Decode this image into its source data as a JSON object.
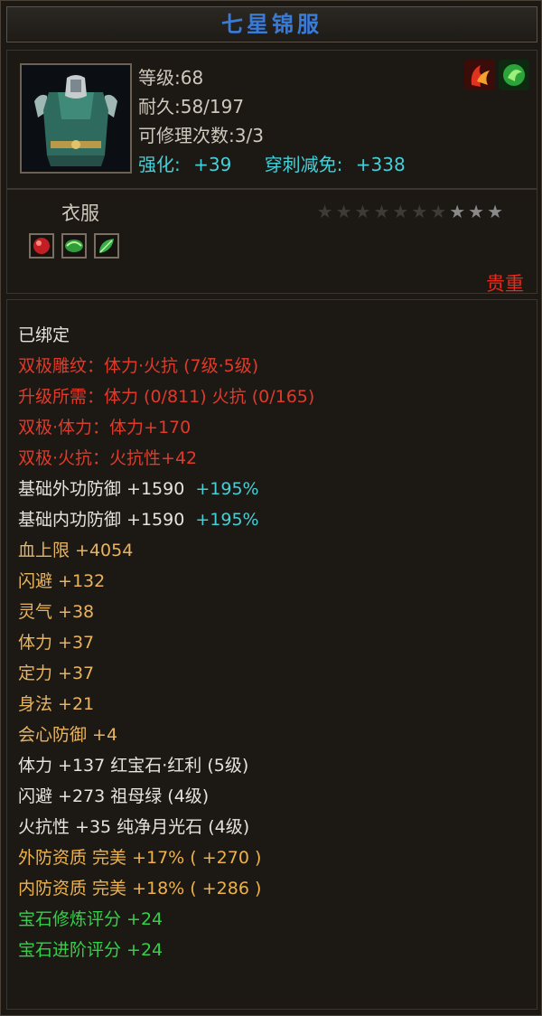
{
  "item": {
    "name": "七星锦服",
    "level": "等级:68",
    "durability": "耐久:58/197",
    "repairs": "可修理次数:3/3",
    "enhance_label": "强化:",
    "enhance_value": "+39",
    "pierce_label": "穿刺减免:",
    "pierce_value": "+338",
    "type": "衣服",
    "rarity": "贵重",
    "stars_total": 10,
    "stars_dim": 7
  },
  "details": {
    "bound": "已绑定",
    "twin_pattern": "双极雕纹：体力·火抗 (7级·5级)",
    "upgrade_req": "升级所需：体力 (0/811)   火抗 (0/165)",
    "twin_vit": "双极·体力：体力+170",
    "twin_fire": "双极·火抗：火抗性+42",
    "ext_def_label": "基础外功防御 +1590",
    "ext_def_pct": "+195%",
    "int_def_label": "基础内功防御 +1590",
    "int_def_pct": "+195%",
    "hp": "血上限 +4054",
    "dodge": "闪避 +132",
    "spirit": "灵气 +38",
    "vitality": "体力 +37",
    "focus": "定力 +37",
    "agility": "身法 +21",
    "crit_def": "会心防御 +4",
    "gem1": "体力 +137 红宝石·红利 (5级)",
    "gem2": "闪避 +273 祖母绿 (4级)",
    "gem3": "火抗性 +35 纯净月光石 (4级)",
    "qual_ext": "外防资质   完美 +17% ( +270 )",
    "qual_int": "内防资质   完美 +18% ( +286 )",
    "gem_refine": "宝石修炼评分 +24",
    "gem_advance": "宝石进阶评分 +24"
  },
  "colors": {
    "title": "#3a7bd8",
    "red": "#e03a2a",
    "gold": "#e8b460",
    "green": "#34d04a",
    "cyan": "#45cfd8"
  },
  "icons": [
    "armor-portrait",
    "red-claw-badge",
    "green-swirl-badge",
    "red-gem-slot",
    "green-gem-slot",
    "leaf-gem-slot"
  ]
}
